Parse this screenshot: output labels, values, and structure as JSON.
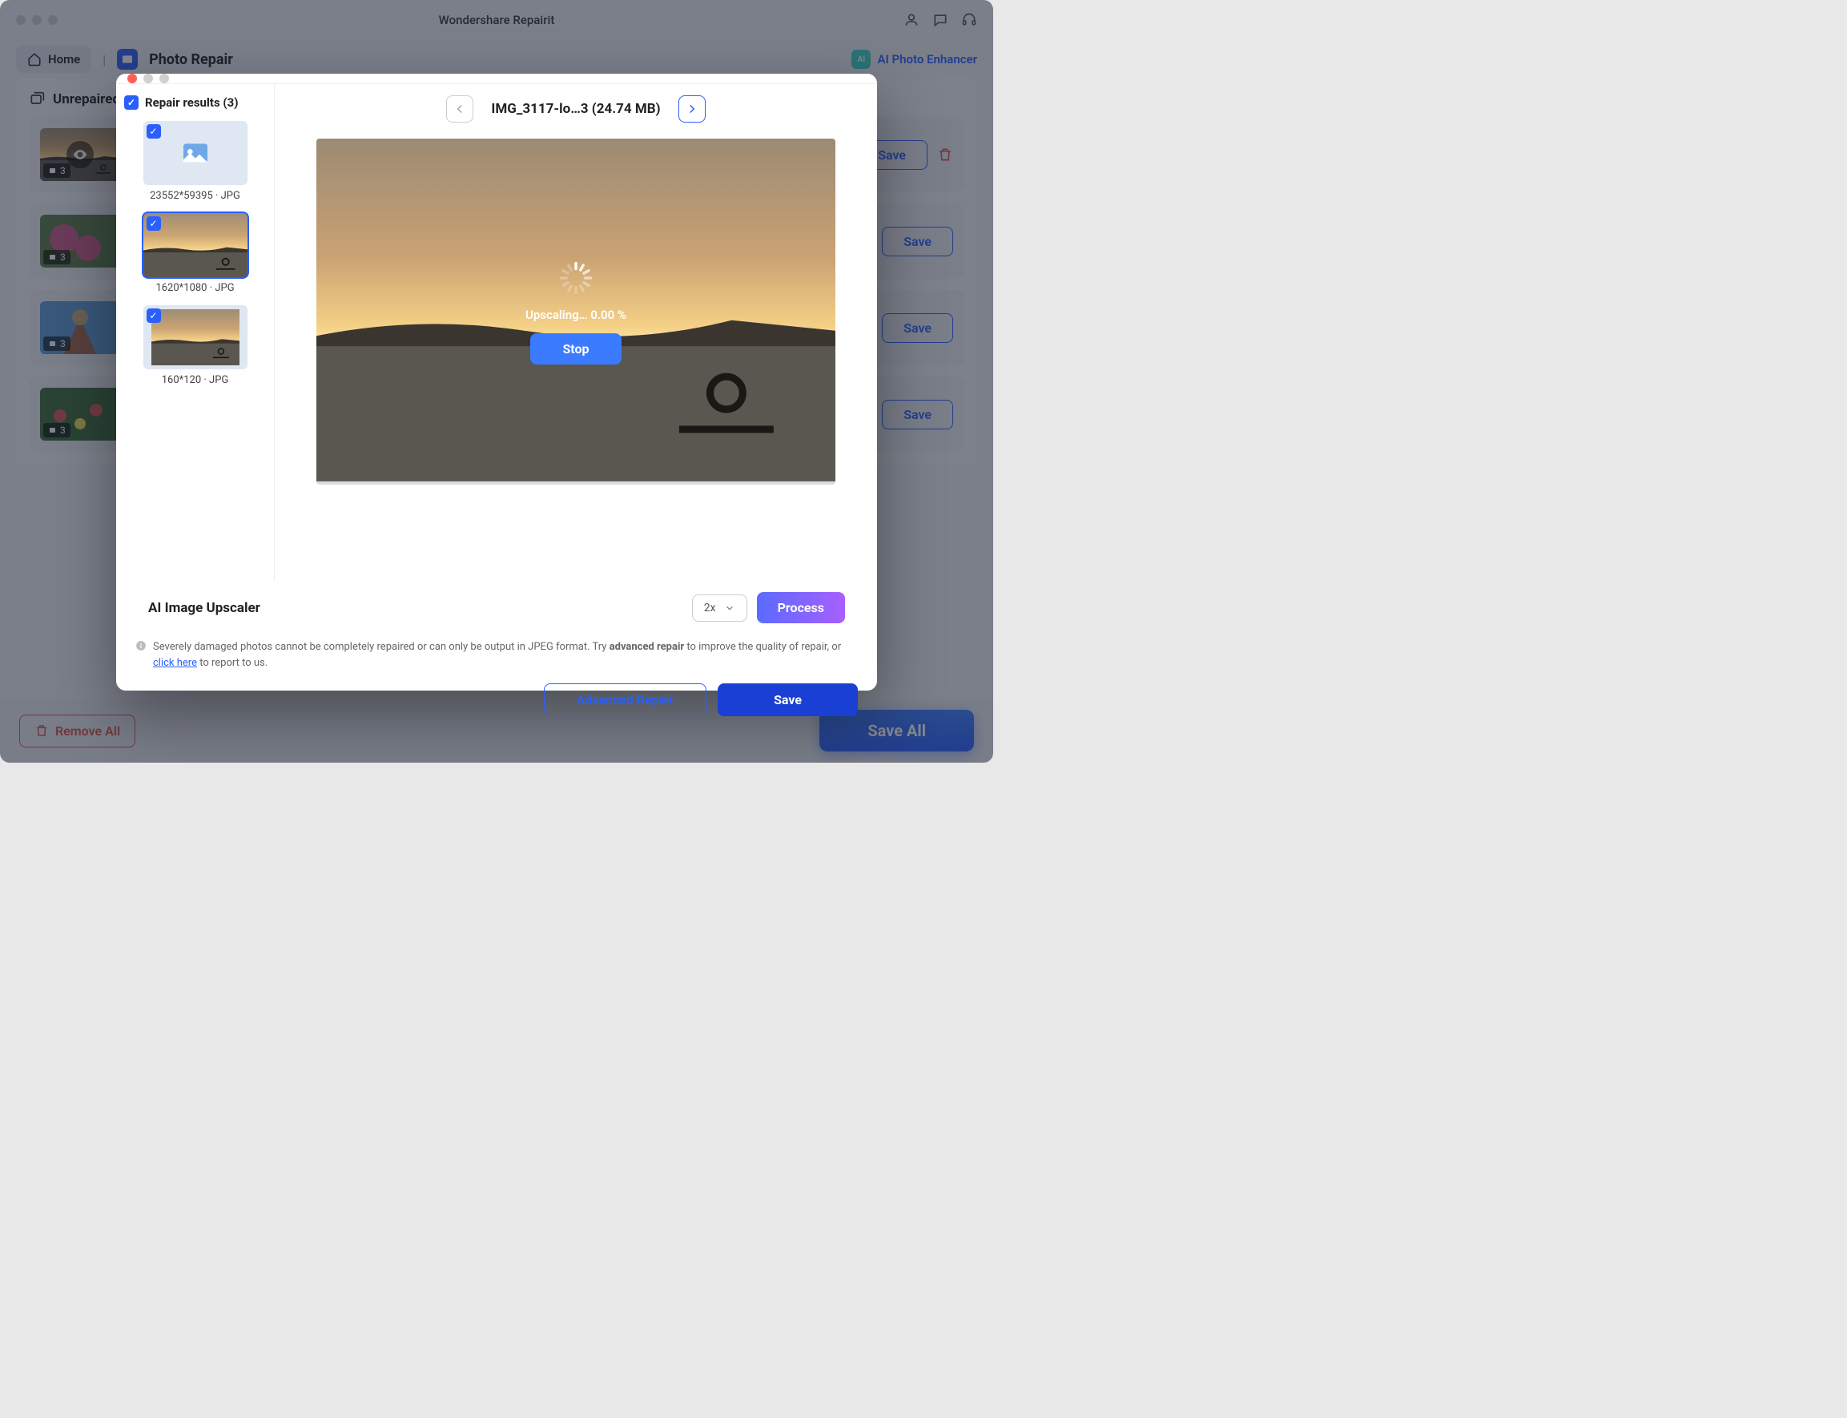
{
  "app_title": "Wondershare Repairit",
  "breadcrumb": {
    "home": "Home",
    "section": "Photo Repair"
  },
  "ai_enhancer": "AI Photo Enhancer",
  "category_title": "Unrepaired",
  "cards": [
    {
      "count": "3",
      "save": "Save"
    },
    {
      "count": "3",
      "save": "Save"
    },
    {
      "count": "3",
      "save": "Save"
    },
    {
      "count": "3",
      "save": "Save"
    }
  ],
  "footer": {
    "remove_all": "Remove All",
    "save_all": "Save All"
  },
  "modal": {
    "file_label": "IMG_3117-lo…3 (24.74 MB)",
    "results_head": "Repair results (3)",
    "results": [
      {
        "dims": "23552*59395 · JPG"
      },
      {
        "dims": "1620*1080 · JPG"
      },
      {
        "dims": "160*120 · JPG"
      }
    ],
    "progress": "Upscaling… 0.00 %",
    "stop": "Stop",
    "upscaler_title": "AI Image Upscaler",
    "scale": "2x",
    "process": "Process",
    "note_pre": "Severely damaged photos cannot be completely repaired or can only be output in JPEG format. Try ",
    "note_strong": "advanced repair",
    "note_mid": " to improve the quality of repair, or ",
    "note_link": "click here",
    "note_post": " to report to us.",
    "advanced_repair": "Advanced Repair",
    "save": "Save"
  }
}
